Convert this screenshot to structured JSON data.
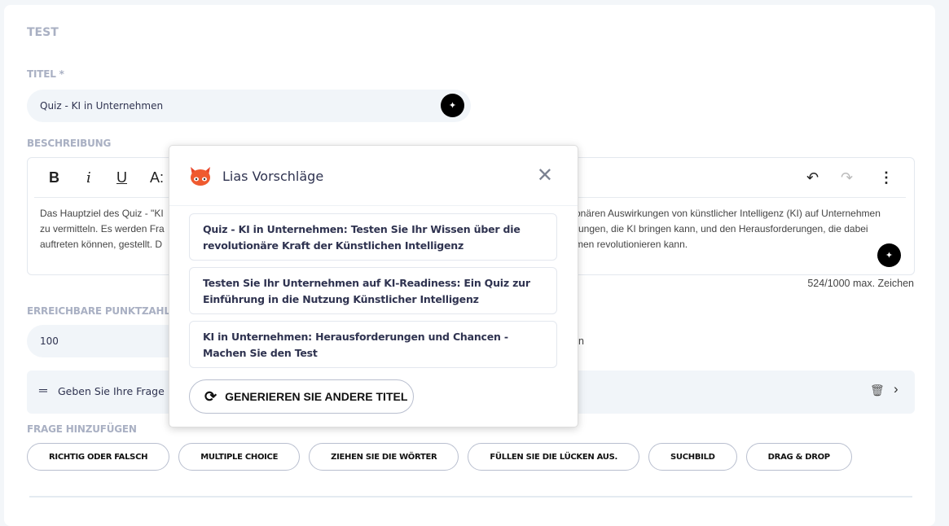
{
  "section_title": "TEST",
  "title_label": "TITEL *",
  "title_value": "Quiz - KI in Unternehmen",
  "description_label": "BESCHREIBUNG",
  "toolbar": {
    "bold": "B",
    "italic": "i",
    "underline": "U",
    "font_size": "A:"
  },
  "description_lines": [
    "Das Hauptziel des Quiz - \"KI",
    "onären Auswirkungen von künstlicher Intelligenz (KI) auf Unternehmen",
    "zu vermitteln. Es werden Fra",
    "rungen, die KI bringen kann, und den Herausforderungen, die dabei",
    "auftreten können, gestellt. D",
    "men revolutionieren kann."
  ],
  "char_count": "524/1000 max. Zeichen",
  "points_label": "ERREICHBARE PUNKTZAHL",
  "points_value": "100",
  "points_side_fragment": "n",
  "question_placeholder": "Geben Sie Ihre Frage",
  "add_question_label": "FRAGE HINZUFÜGEN",
  "question_types": [
    "RICHTIG ODER FALSCH",
    "MULTIPLE CHOICE",
    "ZIEHEN SIE DIE WÖRTER",
    "FÜLLEN SIE DIE LÜCKEN AUS.",
    "SUCHBILD",
    "DRAG & DROP"
  ],
  "popup": {
    "title": "Lias Vorschläge",
    "suggestions": [
      "Quiz - KI in Unternehmen: Testen Sie Ihr Wissen über die revolutionäre Kraft der Künstlichen Intelligenz",
      "Testen Sie Ihr Unternehmen auf KI-Readiness: Ein Quiz zur Einführung in die Nutzung Künstlicher Intelligenz",
      "KI in Unternehmen: Herausforderungen und Chancen - Machen Sie den Test"
    ],
    "generate_label": "GENERIEREN SIE ANDERE TITEL"
  }
}
